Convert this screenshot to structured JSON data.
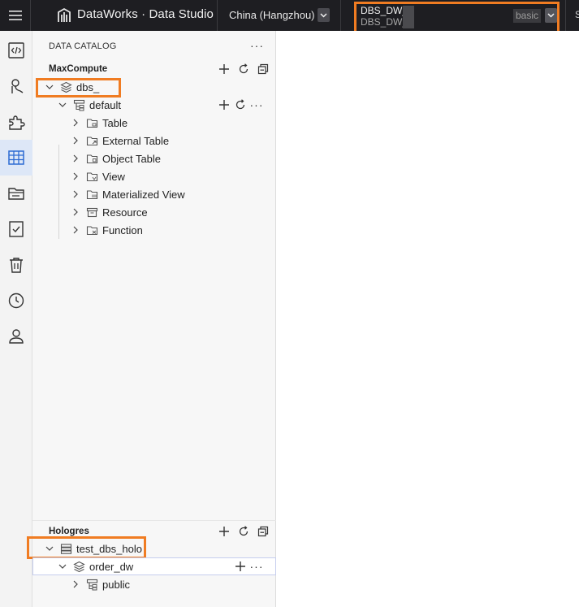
{
  "topbar": {
    "brand": "DataWorks · Data Studio",
    "region": "China (Hangzhou)",
    "workspace_name": "DBS_DW_",
    "workspace_display": "DBS_DW_",
    "workspace_env": "basic",
    "edge_text": "S"
  },
  "rail": {
    "items": [
      {
        "icon": "code-icon",
        "active": false
      },
      {
        "icon": "flow-icon",
        "active": false
      },
      {
        "icon": "puzzle-icon",
        "active": false
      },
      {
        "icon": "table-grid-icon",
        "active": true
      },
      {
        "icon": "folder-icon",
        "active": false
      },
      {
        "icon": "checklist-icon",
        "active": false
      },
      {
        "icon": "trash-icon",
        "active": false
      },
      {
        "icon": "clock-icon",
        "active": false
      },
      {
        "icon": "user-icon",
        "active": false
      }
    ]
  },
  "catalog": {
    "title": "DATA CATALOG",
    "more": "···",
    "maxcompute": {
      "title": "MaxCompute",
      "project": "dbs_",
      "schema": "default",
      "items": [
        "Table",
        "External Table",
        "Object Table",
        "View",
        "Materialized View",
        "Resource",
        "Function"
      ]
    },
    "hologres": {
      "title": "Hologres",
      "instance": "test_dbs_holo",
      "database": "order_dw",
      "schema": "public"
    }
  },
  "colors": {
    "highlight": "#f07c22",
    "topbar": "#1e1e22",
    "active_rail": "#dde7f7"
  }
}
